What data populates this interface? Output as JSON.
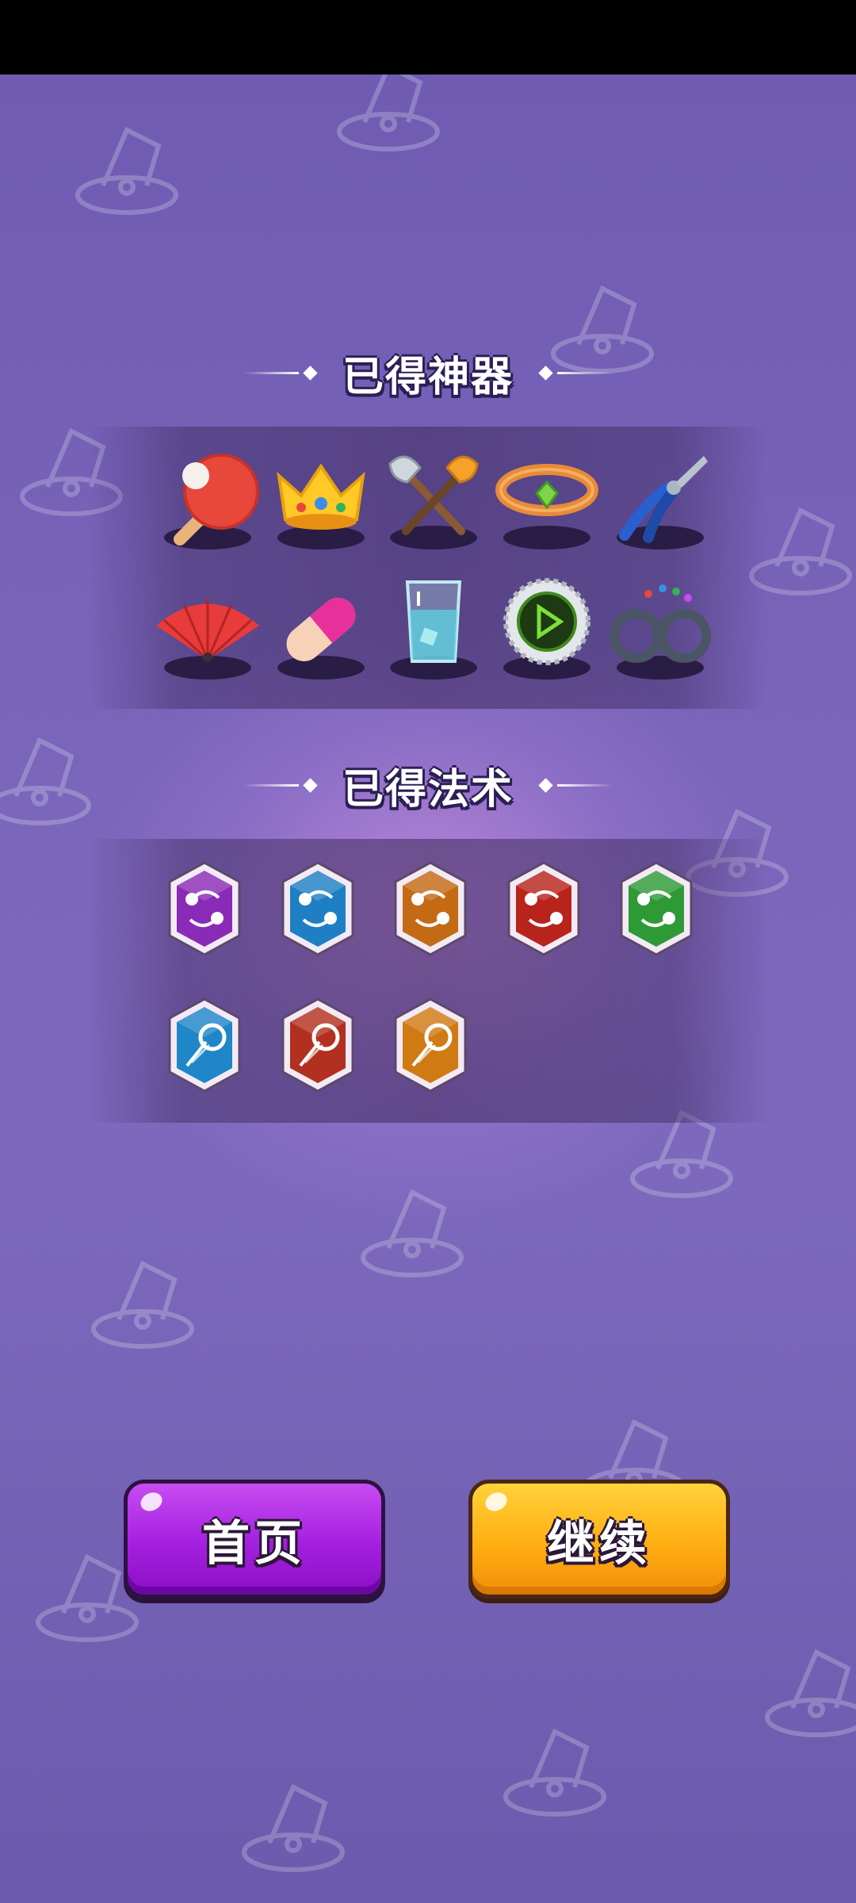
{
  "artifacts_section": {
    "title": "已得神器",
    "items": [
      {
        "icon": "ping-pong-paddle-icon"
      },
      {
        "icon": "crown-icon"
      },
      {
        "icon": "crossed-axes-icon"
      },
      {
        "icon": "gem-ring-icon"
      },
      {
        "icon": "pliers-icon"
      },
      {
        "icon": "folding-fan-icon"
      },
      {
        "icon": "pill-capsule-icon"
      },
      {
        "icon": "glass-of-water-icon"
      },
      {
        "icon": "bottle-cap-icon"
      },
      {
        "icon": "handcuffs-icon"
      }
    ]
  },
  "spells_section": {
    "title": "已得法术",
    "items": [
      {
        "icon": "orbit-spell-icon",
        "color": "#8a2bb8"
      },
      {
        "icon": "orbit-spell-icon",
        "color": "#1f7fc4"
      },
      {
        "icon": "orbit-spell-icon",
        "color": "#c46a14"
      },
      {
        "icon": "orbit-spell-icon",
        "color": "#b8241c"
      },
      {
        "icon": "orbit-spell-icon",
        "color": "#2e9a36"
      },
      {
        "icon": "comet-spell-icon",
        "color": "#1f86c8"
      },
      {
        "icon": "comet-spell-icon",
        "color": "#b23020"
      },
      {
        "icon": "comet-spell-icon",
        "color": "#d07a14"
      }
    ]
  },
  "buttons": {
    "home_label": "首页",
    "continue_label": "继续"
  },
  "colors": {
    "background": "#6f5cb2",
    "home_button": "#a41fe0",
    "continue_button": "#ffae12"
  }
}
